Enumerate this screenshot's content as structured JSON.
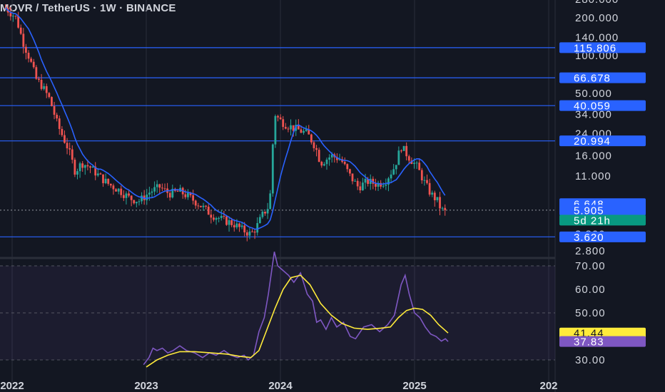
{
  "header": {
    "title": "MOVR / TetherUS · 1W · BINANCE"
  },
  "colors": {
    "background": "#131722",
    "up": "#26a69a",
    "down": "#ef5350",
    "ma": "#2962ff",
    "level_line": "#2962ff",
    "rsi": "#7e57c2",
    "rsi_ma": "#ffeb3b",
    "rsi_band": "#7e57c2",
    "grid": "#2a2e39"
  },
  "chart_data": [
    {
      "type": "candlestick",
      "pair": "MOVR / TetherUS",
      "interval": "1W",
      "exchange": "BINANCE",
      "scale": "log",
      "ylim": [
        2.6,
        290
      ],
      "y_ticks": [
        "280.000",
        "200.000",
        "140.000",
        "100.000",
        "50.000",
        "34.000",
        "24.000",
        "16.000",
        "11.000",
        "2.800"
      ],
      "x_ticks": [
        "2022",
        "2023",
        "2024",
        "2025",
        "202"
      ],
      "horizontal_levels": [
        115.806,
        66.678,
        40.059,
        20.994,
        3.62
      ],
      "level_labels": [
        "115.806",
        "66.678",
        "40.059",
        "20.994",
        "3.620"
      ],
      "last_price": 5.905,
      "last_price_label": "5.905",
      "ma_value": 6.648,
      "ma_label": "6.648",
      "countdown": "5d 21h",
      "hidden_tick_label": "3.800",
      "price_path": [
        {
          "t": 2021.95,
          "v": 240
        },
        {
          "t": 2022.03,
          "v": 200
        },
        {
          "t": 2022.08,
          "v": 130
        },
        {
          "t": 2022.13,
          "v": 95
        },
        {
          "t": 2022.18,
          "v": 65
        },
        {
          "t": 2022.22,
          "v": 58
        },
        {
          "t": 2022.28,
          "v": 45
        },
        {
          "t": 2022.34,
          "v": 28
        },
        {
          "t": 2022.42,
          "v": 18
        },
        {
          "t": 2022.47,
          "v": 12
        },
        {
          "t": 2022.52,
          "v": 14
        },
        {
          "t": 2022.58,
          "v": 13
        },
        {
          "t": 2022.65,
          "v": 11
        },
        {
          "t": 2022.72,
          "v": 9.5
        },
        {
          "t": 2022.8,
          "v": 8.5
        },
        {
          "t": 2022.88,
          "v": 7.3
        },
        {
          "t": 2022.95,
          "v": 7
        },
        {
          "t": 2023.03,
          "v": 8.3
        },
        {
          "t": 2023.1,
          "v": 9
        },
        {
          "t": 2023.17,
          "v": 8
        },
        {
          "t": 2023.25,
          "v": 8.3
        },
        {
          "t": 2023.32,
          "v": 7.5
        },
        {
          "t": 2023.4,
          "v": 6.5
        },
        {
          "t": 2023.48,
          "v": 5.5
        },
        {
          "t": 2023.56,
          "v": 5
        },
        {
          "t": 2023.65,
          "v": 4.6
        },
        {
          "t": 2023.72,
          "v": 4.1
        },
        {
          "t": 2023.78,
          "v": 3.8
        },
        {
          "t": 2023.82,
          "v": 4.3
        },
        {
          "t": 2023.87,
          "v": 5.5
        },
        {
          "t": 2023.92,
          "v": 6.5
        },
        {
          "t": 2023.955,
          "v": 35
        },
        {
          "t": 2023.99,
          "v": 31
        },
        {
          "t": 2024.05,
          "v": 28
        },
        {
          "t": 2024.12,
          "v": 26
        },
        {
          "t": 2024.2,
          "v": 24
        },
        {
          "t": 2024.26,
          "v": 19
        },
        {
          "t": 2024.3,
          "v": 14
        },
        {
          "t": 2024.38,
          "v": 16
        },
        {
          "t": 2024.45,
          "v": 15
        },
        {
          "t": 2024.52,
          "v": 11
        },
        {
          "t": 2024.58,
          "v": 9
        },
        {
          "t": 2024.65,
          "v": 10
        },
        {
          "t": 2024.72,
          "v": 9.5
        },
        {
          "t": 2024.78,
          "v": 10
        },
        {
          "t": 2024.85,
          "v": 13
        },
        {
          "t": 2024.9,
          "v": 19
        },
        {
          "t": 2024.95,
          "v": 16
        },
        {
          "t": 2025.02,
          "v": 13
        },
        {
          "t": 2025.07,
          "v": 10
        },
        {
          "t": 2025.12,
          "v": 8
        },
        {
          "t": 2025.17,
          "v": 7
        },
        {
          "t": 2025.2,
          "v": 5.9
        },
        {
          "t": 2025.24,
          "v": 5.9
        }
      ]
    },
    {
      "type": "line",
      "indicator": "RSI",
      "ylim": [
        26,
        75
      ],
      "y_ticks": [
        "70.00",
        "60.00",
        "50.00",
        "30.00"
      ],
      "band": [
        30,
        70
      ],
      "rsi_value": 37.83,
      "rsi_label": "37.83",
      "rsi_ma_value": 41.44,
      "rsi_ma_label": "41.44",
      "series": [
        {
          "indicator": "RSI",
          "points": [
            {
              "t": 2022.98,
              "v": 28
            },
            {
              "t": 2023.02,
              "v": 31
            },
            {
              "t": 2023.05,
              "v": 35
            },
            {
              "t": 2023.08,
              "v": 34
            },
            {
              "t": 2023.12,
              "v": 35
            },
            {
              "t": 2023.16,
              "v": 33
            },
            {
              "t": 2023.2,
              "v": 34
            },
            {
              "t": 2023.25,
              "v": 36
            },
            {
              "t": 2023.3,
              "v": 34
            },
            {
              "t": 2023.36,
              "v": 33
            },
            {
              "t": 2023.42,
              "v": 31
            },
            {
              "t": 2023.47,
              "v": 33
            },
            {
              "t": 2023.52,
              "v": 32
            },
            {
              "t": 2023.58,
              "v": 34
            },
            {
              "t": 2023.63,
              "v": 32
            },
            {
              "t": 2023.68,
              "v": 31
            },
            {
              "t": 2023.73,
              "v": 32
            },
            {
              "t": 2023.76,
              "v": 30
            },
            {
              "t": 2023.8,
              "v": 32
            },
            {
              "t": 2023.84,
              "v": 42
            },
            {
              "t": 2023.88,
              "v": 48
            },
            {
              "t": 2023.91,
              "v": 58
            },
            {
              "t": 2023.955,
              "v": 76
            },
            {
              "t": 2023.98,
              "v": 70
            },
            {
              "t": 2024.02,
              "v": 68
            },
            {
              "t": 2024.06,
              "v": 66
            },
            {
              "t": 2024.1,
              "v": 63
            },
            {
              "t": 2024.15,
              "v": 67
            },
            {
              "t": 2024.2,
              "v": 58
            },
            {
              "t": 2024.24,
              "v": 55
            },
            {
              "t": 2024.27,
              "v": 46
            },
            {
              "t": 2024.3,
              "v": 47
            },
            {
              "t": 2024.34,
              "v": 43
            },
            {
              "t": 2024.38,
              "v": 48
            },
            {
              "t": 2024.42,
              "v": 44
            },
            {
              "t": 2024.47,
              "v": 46
            },
            {
              "t": 2024.52,
              "v": 40
            },
            {
              "t": 2024.56,
              "v": 39
            },
            {
              "t": 2024.62,
              "v": 44
            },
            {
              "t": 2024.68,
              "v": 45
            },
            {
              "t": 2024.74,
              "v": 42
            },
            {
              "t": 2024.8,
              "v": 45
            },
            {
              "t": 2024.85,
              "v": 49
            },
            {
              "t": 2024.9,
              "v": 62
            },
            {
              "t": 2024.93,
              "v": 66
            },
            {
              "t": 2024.96,
              "v": 58
            },
            {
              "t": 2025.0,
              "v": 50
            },
            {
              "t": 2025.04,
              "v": 48
            },
            {
              "t": 2025.08,
              "v": 44
            },
            {
              "t": 2025.12,
              "v": 41
            },
            {
              "t": 2025.16,
              "v": 40
            },
            {
              "t": 2025.2,
              "v": 38
            },
            {
              "t": 2025.23,
              "v": 39
            },
            {
              "t": 2025.25,
              "v": 37.83
            }
          ]
        },
        {
          "indicator": "RSI-based MA",
          "points": [
            {
              "t": 2023.0,
              "v": 27
            },
            {
              "t": 2023.08,
              "v": 30
            },
            {
              "t": 2023.16,
              "v": 32
            },
            {
              "t": 2023.25,
              "v": 33.5
            },
            {
              "t": 2023.36,
              "v": 33.5
            },
            {
              "t": 2023.48,
              "v": 33
            },
            {
              "t": 2023.6,
              "v": 32.5
            },
            {
              "t": 2023.7,
              "v": 31.5
            },
            {
              "t": 2023.78,
              "v": 31
            },
            {
              "t": 2023.84,
              "v": 34
            },
            {
              "t": 2023.9,
              "v": 43
            },
            {
              "t": 2023.96,
              "v": 52
            },
            {
              "t": 2024.02,
              "v": 60
            },
            {
              "t": 2024.08,
              "v": 65
            },
            {
              "t": 2024.15,
              "v": 66
            },
            {
              "t": 2024.22,
              "v": 62
            },
            {
              "t": 2024.3,
              "v": 54
            },
            {
              "t": 2024.38,
              "v": 49
            },
            {
              "t": 2024.46,
              "v": 45.5
            },
            {
              "t": 2024.55,
              "v": 43.5
            },
            {
              "t": 2024.65,
              "v": 43
            },
            {
              "t": 2024.75,
              "v": 43.5
            },
            {
              "t": 2024.82,
              "v": 44
            },
            {
              "t": 2024.88,
              "v": 48
            },
            {
              "t": 2024.94,
              "v": 51
            },
            {
              "t": 2025.0,
              "v": 52
            },
            {
              "t": 2025.06,
              "v": 51.5
            },
            {
              "t": 2025.12,
              "v": 49
            },
            {
              "t": 2025.18,
              "v": 45
            },
            {
              "t": 2025.25,
              "v": 41.44
            }
          ]
        }
      ]
    }
  ]
}
